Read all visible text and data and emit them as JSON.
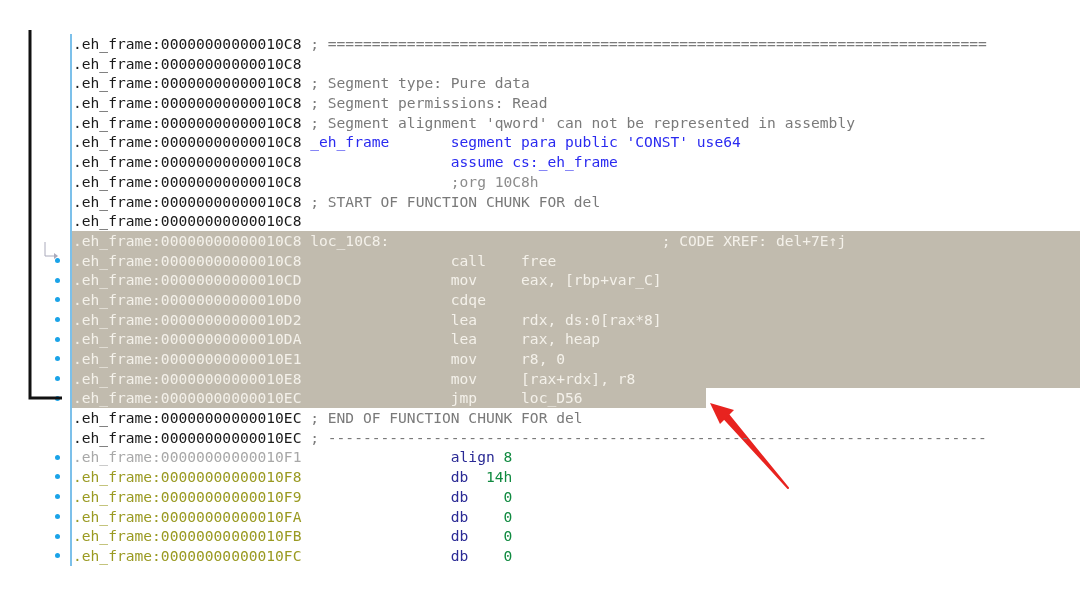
{
  "listing": {
    "rows": [
      {
        "address": ".eh_frame:00000000000010C8",
        "kind": "code",
        "dot": false,
        "selected": false,
        "cursor": false,
        "comment": "; ==========================================================================="
      },
      {
        "address": ".eh_frame:00000000000010C8",
        "kind": "code",
        "dot": false,
        "selected": false,
        "cursor": false
      },
      {
        "address": ".eh_frame:00000000000010C8",
        "kind": "code",
        "dot": false,
        "selected": false,
        "cursor": false,
        "comment": "; Segment type: Pure data"
      },
      {
        "address": ".eh_frame:00000000000010C8",
        "kind": "code",
        "dot": false,
        "selected": false,
        "cursor": false,
        "comment": "; Segment permissions: Read"
      },
      {
        "address": ".eh_frame:00000000000010C8",
        "kind": "code",
        "dot": false,
        "selected": false,
        "cursor": false,
        "comment": "; Segment alignment 'qword' can not be represented in assembly"
      },
      {
        "address": ".eh_frame:00000000000010C8",
        "kind": "code",
        "dot": false,
        "selected": false,
        "cursor": false,
        "label": "_eh_frame",
        "instruction": {
          "kind": "directive",
          "text": "segment para public 'CONST' use64"
        }
      },
      {
        "address": ".eh_frame:00000000000010C8",
        "kind": "code",
        "dot": false,
        "selected": false,
        "cursor": false,
        "instruction": {
          "kind": "directive",
          "text": "assume cs:_eh_frame"
        }
      },
      {
        "address": ".eh_frame:00000000000010C8",
        "kind": "code",
        "dot": false,
        "selected": false,
        "cursor": false,
        "instruction": {
          "kind": "comment",
          "text": ";org 10C8h"
        }
      },
      {
        "address": ".eh_frame:00000000000010C8",
        "kind": "code",
        "dot": false,
        "selected": false,
        "cursor": false,
        "comment": "; START OF FUNCTION CHUNK FOR del"
      },
      {
        "address": ".eh_frame:00000000000010C8",
        "kind": "code",
        "dot": false,
        "selected": false,
        "cursor": false
      },
      {
        "address": ".eh_frame:00000000000010C8",
        "kind": "code",
        "dot": false,
        "selected": true,
        "cursor": false,
        "label": "loc_10C8:",
        "comment": "; CODE XREF: del+7E↑j"
      },
      {
        "address": ".eh_frame:00000000000010C8",
        "kind": "code",
        "dot": true,
        "selected": true,
        "cursor": false,
        "instruction": {
          "kind": "code",
          "mnemonic": "call",
          "operands": "free"
        }
      },
      {
        "address": ".eh_frame:00000000000010CD",
        "kind": "code",
        "dot": true,
        "selected": true,
        "cursor": false,
        "instruction": {
          "kind": "code",
          "mnemonic": "mov",
          "operands": "eax, [rbp+var_C]"
        }
      },
      {
        "address": ".eh_frame:00000000000010D0",
        "kind": "code",
        "dot": true,
        "selected": true,
        "cursor": false,
        "instruction": {
          "kind": "code",
          "mnemonic": "cdqe"
        }
      },
      {
        "address": ".eh_frame:00000000000010D2",
        "kind": "code",
        "dot": true,
        "selected": true,
        "cursor": false,
        "instruction": {
          "kind": "code",
          "mnemonic": "lea",
          "operands": "rdx, ds:0[rax*8]"
        }
      },
      {
        "address": ".eh_frame:00000000000010DA",
        "kind": "code",
        "dot": true,
        "selected": true,
        "cursor": false,
        "instruction": {
          "kind": "code",
          "mnemonic": "lea",
          "operands": "rax, heap"
        }
      },
      {
        "address": ".eh_frame:00000000000010E1",
        "kind": "code",
        "dot": true,
        "selected": true,
        "cursor": false,
        "instruction": {
          "kind": "code",
          "mnemonic": "mov",
          "operands": "r8, 0"
        }
      },
      {
        "address": ".eh_frame:00000000000010E8",
        "kind": "code",
        "dot": true,
        "selected": true,
        "cursor": false,
        "instruction": {
          "kind": "code",
          "mnemonic": "mov",
          "operands": "[rax+rdx], r8"
        }
      },
      {
        "address": ".eh_frame:00000000000010EC",
        "kind": "code",
        "dot": true,
        "selected": true,
        "cursor": true,
        "instruction": {
          "kind": "code",
          "mnemonic": "jmp",
          "operands": "loc_D56"
        }
      },
      {
        "address": ".eh_frame:00000000000010EC",
        "kind": "code",
        "dot": false,
        "selected": false,
        "cursor": false,
        "comment": "; END OF FUNCTION CHUNK FOR del"
      },
      {
        "address": ".eh_frame:00000000000010EC",
        "kind": "code",
        "dot": false,
        "selected": false,
        "cursor": false,
        "comment": "; ---------------------------------------------------------------------------"
      },
      {
        "address": ".eh_frame:00000000000010F1",
        "kind": "unexplored",
        "dot": true,
        "selected": false,
        "cursor": false,
        "instruction": {
          "kind": "data",
          "mnemonic": "align",
          "operands": "8"
        }
      },
      {
        "address": ".eh_frame:00000000000010F8",
        "kind": "data",
        "dot": true,
        "selected": false,
        "cursor": false,
        "instruction": {
          "kind": "data",
          "mnemonic": "db",
          "operands": "14h"
        }
      },
      {
        "address": ".eh_frame:00000000000010F9",
        "kind": "data",
        "dot": true,
        "selected": false,
        "cursor": false,
        "instruction": {
          "kind": "data",
          "mnemonic": "db",
          "operands": "0"
        }
      },
      {
        "address": ".eh_frame:00000000000010FA",
        "kind": "data",
        "dot": true,
        "selected": false,
        "cursor": false,
        "instruction": {
          "kind": "data",
          "mnemonic": "db",
          "operands": "0"
        }
      },
      {
        "address": ".eh_frame:00000000000010FB",
        "kind": "data",
        "dot": true,
        "selected": false,
        "cursor": false,
        "instruction": {
          "kind": "data",
          "mnemonic": "db",
          "operands": "0"
        }
      },
      {
        "address": ".eh_frame:00000000000010FC",
        "kind": "data",
        "dot": true,
        "selected": false,
        "cursor": false,
        "instruction": {
          "kind": "data",
          "mnemonic": "db",
          "operands": "0"
        }
      }
    ]
  }
}
